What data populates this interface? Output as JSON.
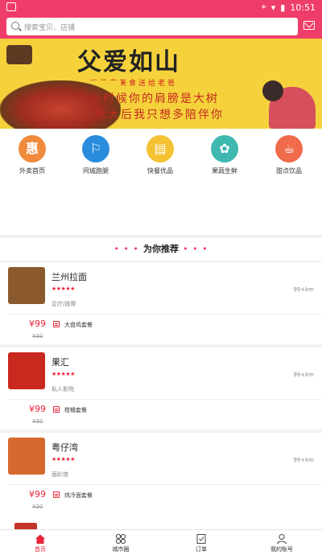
{
  "status_bar": {
    "time": "10:51"
  },
  "search": {
    "placeholder": "搜索宝贝、店铺"
  },
  "banner": {
    "title": "父爱如山",
    "subtitle": "吃健康美食送给老爸",
    "line1": "小时候你的肩膀是大树",
    "line2": "长大后我只想多陪伴你"
  },
  "categories": [
    {
      "label": "外卖首页",
      "color": "#f08a3c",
      "glyph": "惠"
    },
    {
      "label": "同城跑腿",
      "color": "#2a8cde",
      "glyph": "⚐"
    },
    {
      "label": "快餐优品",
      "color": "#f4c233",
      "glyph": "▤"
    },
    {
      "label": "果蔬生鲜",
      "color": "#3fb8b0",
      "glyph": "✿"
    },
    {
      "label": "甜点饮品",
      "color": "#f06a4c",
      "glyph": "☕"
    }
  ],
  "recommend": {
    "title": "为你推荐",
    "dots": "• • •"
  },
  "shops": [
    {
      "name": "兰州拉面",
      "stars": "★★★★★",
      "distance": "99+km",
      "tag": "足疗/按摩",
      "price": "¥99",
      "old_price": "¥30",
      "deal": "大盘鸡套餐",
      "thumb_color": "#8a5a2e"
    },
    {
      "name": "果汇",
      "stars": "★★★★★",
      "distance": "99+km",
      "tag": "私人影院",
      "price": "¥99",
      "old_price": "¥30",
      "deal": "柑橘套餐",
      "thumb_color": "#c9281f"
    },
    {
      "name": "粤仔湾",
      "stars": "★★★★★",
      "distance": "99+km",
      "tag": "面趴馆",
      "price": "¥99",
      "old_price": "¥30",
      "deal": "炜冷面套餐",
      "thumb_color": "#d6692f"
    }
  ],
  "tabbar": [
    {
      "label": "首页",
      "icon": "home-icon",
      "active": true
    },
    {
      "label": "城市圈",
      "icon": "circles-icon",
      "active": false
    },
    {
      "label": "订单",
      "icon": "order-icon",
      "active": false
    },
    {
      "label": "我的账号",
      "icon": "user-icon",
      "active": false
    }
  ],
  "colors": {
    "brand": "#ef3d6a",
    "price": "#e8233a"
  }
}
